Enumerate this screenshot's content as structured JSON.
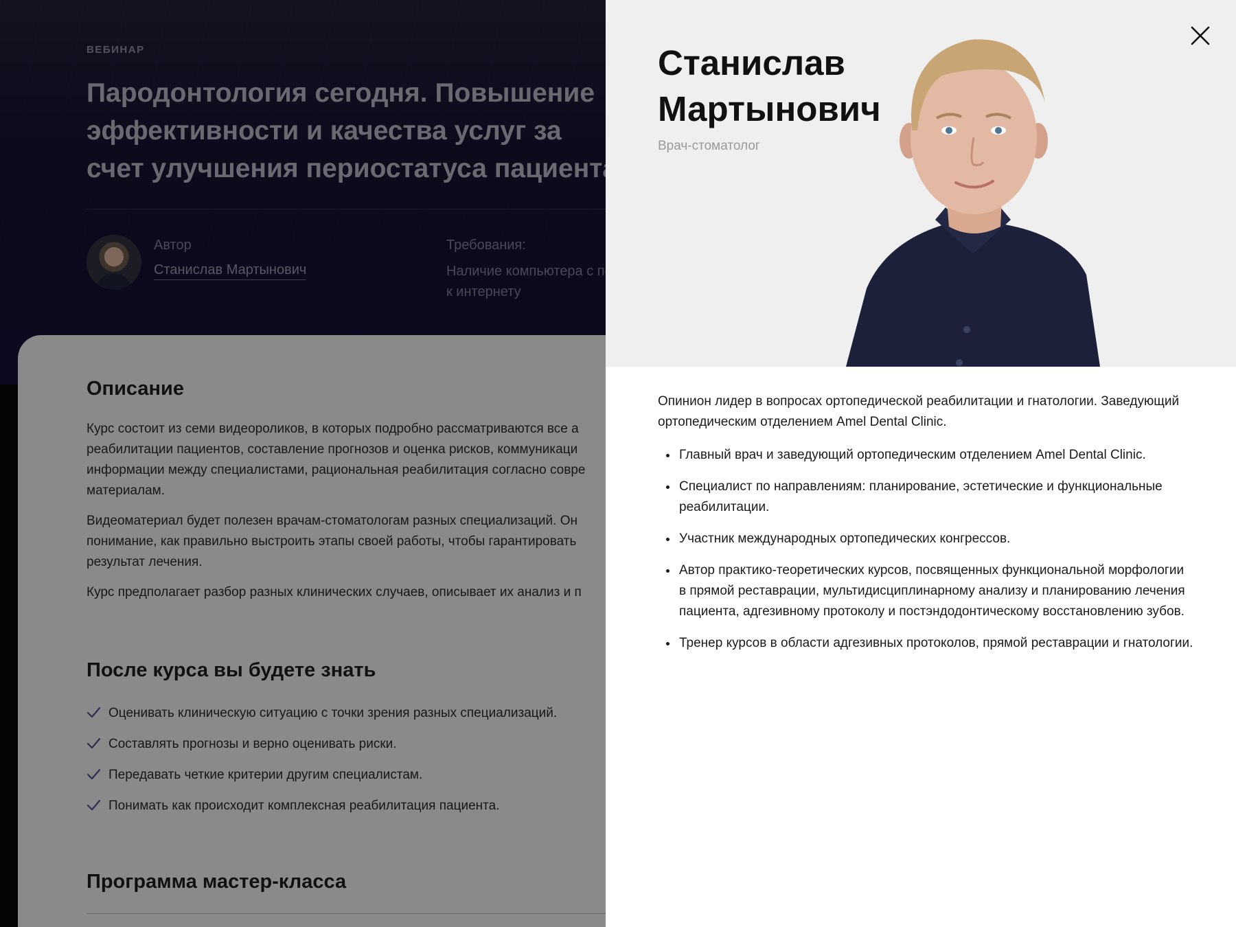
{
  "course": {
    "label": "ВЕБИНАР",
    "title": "Пародонтология сегодня. Повышение эффективности и качества услуг за счет улучшения периостатуса пациента",
    "author_label": "Автор",
    "author_name": "Станислав Мартынович",
    "requirements_label": "Требования:",
    "requirements_text": "Наличие компьютера с по к интернету",
    "description_title": "Описание",
    "description_paragraphs": [
      "Курс состоит из семи видеороликов, в которых подробно рассматриваются все а реабилитации пациентов, составление прогнозов и оценка рисков, коммуникаци информации между специалистами, рациональная реабилитация согласно совре материалам.",
      "Видеоматериал будет полезен врачам-стоматологам разных специализаций. Он понимание, как правильно выстроить этапы своей работы, чтобы гарантировать результат лечения.",
      "Курс предполагает разбор разных клинических случаев, описывает их анализ и п"
    ],
    "skills_title": "После курса вы будете знать",
    "skills": [
      "Оценивать клиническую ситуацию с точки зрения разных специализаций.",
      "Составлять прогнозы и верно оценивать риски.",
      "Передавать четкие критерии другим специалистам.",
      "Понимать как происходит комплексная реабилитация пациента."
    ],
    "program_title": "Программа мастер-класса"
  },
  "speaker": {
    "name": "Станислав Мартынович",
    "role": "Врач-стоматолог",
    "intro": "Опинион лидер в вопросах ортопедической реабилитации и гнатологии. Заведующий ортопедическим отделением Amel Dental Clinic.",
    "bullets": [
      "Главный врач и заведующий ортопедическим отделением Amel Dental Clinic.",
      "Специалист по направлениям: планирование, эстетические и функциональные реабилитации.",
      "Участник международных ортопедических конгрессов.",
      "Автор практико-теоретических курсов, посвященных функциональной морфологии в прямой реставрации, мультидисциплинарному анализу и планированию лечения пациента, адгезивному протоколу и постэндодонтическому восстановлению зубов.",
      "Тренер курсов в области адгезивных протоколов, прямой реставрации и гнатологии."
    ]
  },
  "icons": {
    "close": "close-icon",
    "check": "check-icon",
    "avatar": "avatar"
  },
  "colors": {
    "hero_bg": "#0b0a2e",
    "drawer_bg": "#ffffff",
    "drawer_header_bg": "#efefef",
    "accent_check": "#4a4d8a",
    "overlay": "rgba(12,12,12,0.45)"
  }
}
